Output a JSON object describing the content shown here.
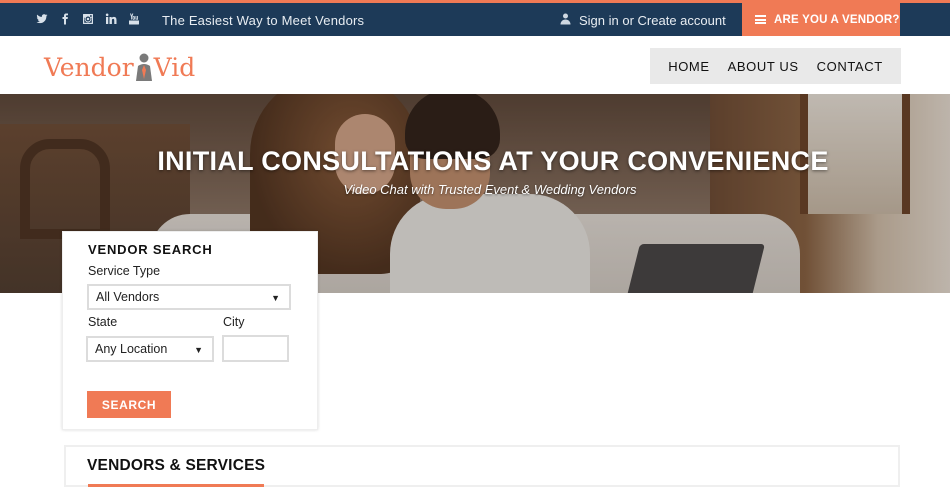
{
  "topbar": {
    "social_icons": [
      "twitter-icon",
      "facebook-icon",
      "instagram-icon",
      "linkedin-icon",
      "youtube-icon"
    ],
    "tagline": "The Easiest Way to Meet Vendors",
    "signin_label": "Sign in or Create account",
    "vendor_button_label": "ARE YOU A VENDOR?"
  },
  "header": {
    "logo_left": "Vendor",
    "logo_right": "Vid",
    "nav": [
      "HOME",
      "ABOUT US",
      "CONTACT"
    ]
  },
  "hero": {
    "title": "INITIAL CONSULTATIONS AT YOUR CONVENIENCE",
    "subtitle": "Video Chat with Trusted Event & Wedding Vendors"
  },
  "search": {
    "heading": "VENDOR SEARCH",
    "service_type_label": "Service Type",
    "service_type_value": "All Vendors",
    "state_label": "State",
    "state_value": "Any Location",
    "city_label": "City",
    "city_value": "",
    "button_label": "SEARCH"
  },
  "vendors_section": {
    "heading": "VENDORS & SERVICES"
  },
  "colors": {
    "accent": "#f07a55",
    "topbar": "#1d3a58",
    "nav_bg": "#e9e9e9"
  }
}
